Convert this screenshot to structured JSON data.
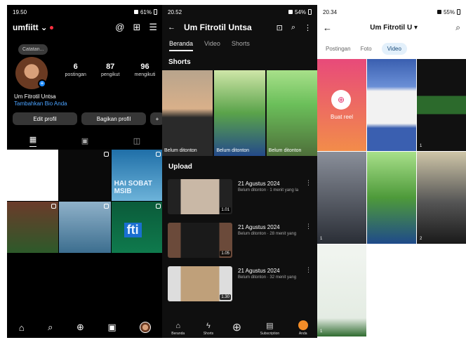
{
  "instagram": {
    "status_time": "19.50",
    "status_battery": "61%",
    "username": "umfiitt",
    "note": "Catatan...",
    "stats": [
      {
        "num": "6",
        "label": "postingan"
      },
      {
        "num": "87",
        "label": "pengikut"
      },
      {
        "num": "96",
        "label": "mengikuti"
      }
    ],
    "name": "Um Fitrotil Untsa",
    "bio_link": "Tambahkan Bio Anda",
    "edit_label": "Edit profil",
    "share_label": "Bagikan profil",
    "grid_texts": [
      "",
      "",
      "HAI SOBAT MSIB",
      "",
      "",
      "fti"
    ]
  },
  "youtube": {
    "status_time": "20.52",
    "status_battery": "54%",
    "title": "Um Fitrotil Untsa",
    "tabs": [
      "Beranda",
      "Video",
      "Shorts"
    ],
    "shorts_heading": "Shorts",
    "shorts": [
      {
        "caption": "Belum ditonton"
      },
      {
        "caption": "Belum ditonton"
      },
      {
        "caption": "Belum ditonton"
      }
    ],
    "upload_heading": "Upload",
    "uploads": [
      {
        "date": "21 Agustus 2024",
        "meta": "Belum ditonton · 1 menit yang la",
        "dur": "1.01"
      },
      {
        "date": "21 Agustus 2024",
        "meta": "Belum ditonton · 28 menit yang",
        "dur": "1.05"
      },
      {
        "date": "21 Agustus 2024",
        "meta": "Belum ditonton · 32 menit yang",
        "dur": "1.30"
      }
    ],
    "nav": [
      "Beranda",
      "Shorts",
      "",
      "Subscription",
      "Anda"
    ]
  },
  "profile3": {
    "status_time": "20.34",
    "status_battery": "55%",
    "title": "Um Fitrotil U",
    "tabs": [
      "Postingan",
      "Foto",
      "Video"
    ],
    "reel_label": "Buat reel",
    "counts": [
      "",
      "",
      "1",
      "1",
      "",
      "2",
      "1"
    ]
  },
  "colors": {
    "ig_link": "#4ba3ff",
    "yt_avatar": "#f28c28",
    "tab_active_bg": "#e3f0fb"
  }
}
